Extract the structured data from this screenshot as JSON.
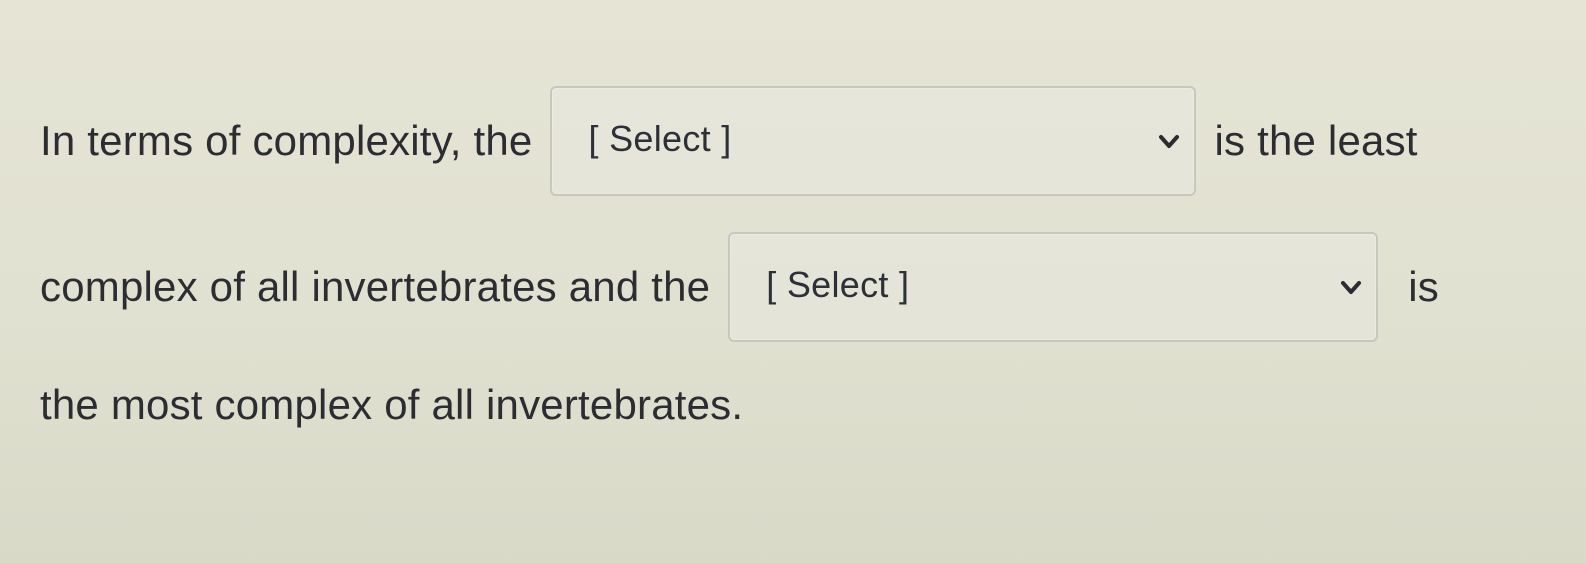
{
  "question": {
    "line1_before": "In terms of complexity, the",
    "line1_after": "is the least",
    "line2_before": "complex of all invertebrates and the",
    "line2_after": "is",
    "line3": "the most complex of all invertebrates."
  },
  "dropdowns": [
    {
      "selected": "[ Select ]",
      "icon": "chevron-down-icon"
    },
    {
      "selected": "[ Select ]",
      "icon": "chevron-down-icon"
    }
  ]
}
